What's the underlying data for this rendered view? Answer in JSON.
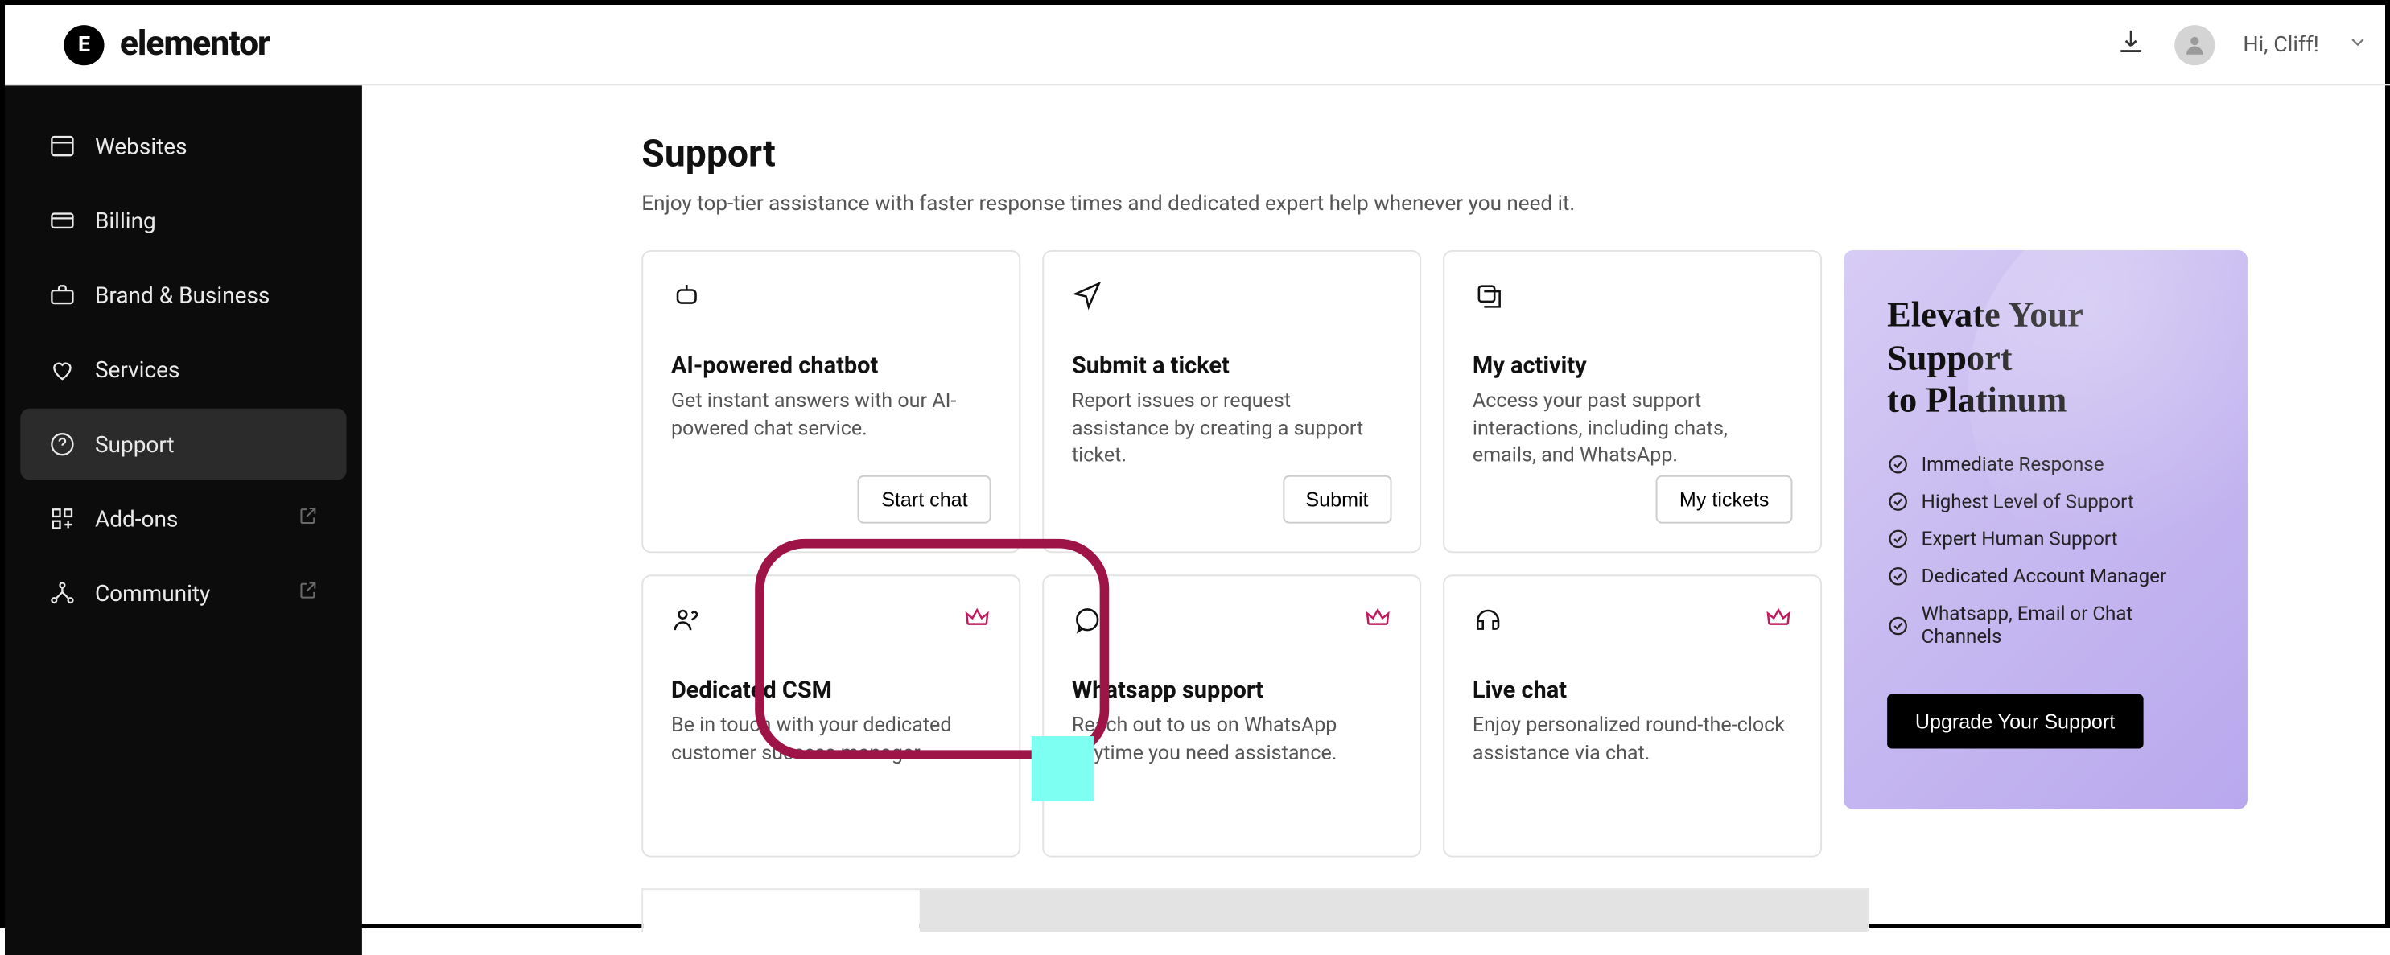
{
  "brand": {
    "name": "elementor",
    "badge_letter": "E"
  },
  "header": {
    "greeting": "Hi, Cliff!"
  },
  "sidebar": {
    "items": [
      {
        "label": "Websites",
        "icon": "window-icon",
        "external": false
      },
      {
        "label": "Billing",
        "icon": "card-icon",
        "external": false
      },
      {
        "label": "Brand & Business",
        "icon": "briefcase-icon",
        "external": false
      },
      {
        "label": "Services",
        "icon": "heart-hand-icon",
        "external": false
      },
      {
        "label": "Support",
        "icon": "help-icon",
        "external": false,
        "active": true
      },
      {
        "label": "Add-ons",
        "icon": "grid-plus-icon",
        "external": true
      },
      {
        "label": "Community",
        "icon": "network-icon",
        "external": true
      }
    ]
  },
  "page": {
    "title": "Support",
    "subtitle": "Enjoy top-tier assistance with faster response times and dedicated expert help whenever you need it."
  },
  "cards": {
    "chatbot": {
      "title": "AI-powered chatbot",
      "desc": "Get instant answers with our AI-powered chat service.",
      "button": "Start chat"
    },
    "ticket": {
      "title": "Submit a ticket",
      "desc": "Report issues or request assistance by creating a support ticket.",
      "button": "Submit"
    },
    "activity": {
      "title": "My activity",
      "desc": "Access your past support interactions, including chats, emails, and WhatsApp.",
      "button": "My tickets"
    },
    "csm": {
      "title": "Dedicated CSM",
      "desc": "Be in touch with your dedicated customer success manager.",
      "premium": true
    },
    "whatsapp": {
      "title": "Whatsapp support",
      "desc": "Reach out to us on WhatsApp anytime you need assistance.",
      "premium": true
    },
    "livechat": {
      "title": "Live chat",
      "desc": "Enjoy personalized round-the-clock assistance via chat.",
      "premium": true
    }
  },
  "promo": {
    "title_line1": "Elevate Your Support",
    "title_line2": "to Platinum",
    "bullets": [
      "Immediate Response",
      "Highest Level of Support",
      "Expert Human Support",
      "Dedicated Account Manager",
      "Whatsapp, Email or Chat Channels"
    ],
    "cta": "Upgrade Your Support"
  }
}
